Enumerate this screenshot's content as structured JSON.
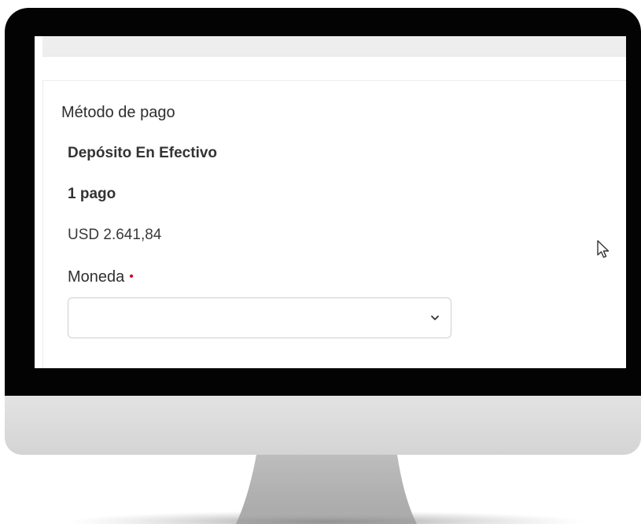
{
  "payment_section": {
    "title": "Método de pago",
    "method": "Depósito En Efectivo",
    "installments": "1 pago",
    "amount": "USD 2.641,84",
    "currency_field": {
      "label": "Moneda",
      "required_marker": "•",
      "value": ""
    }
  },
  "icons": {
    "dropdown": "chevron-down-icon",
    "pointer": "mouse-cursor-icon"
  },
  "colors": {
    "bezel": "#030303",
    "required": "#c8102e",
    "text": "#303030"
  }
}
